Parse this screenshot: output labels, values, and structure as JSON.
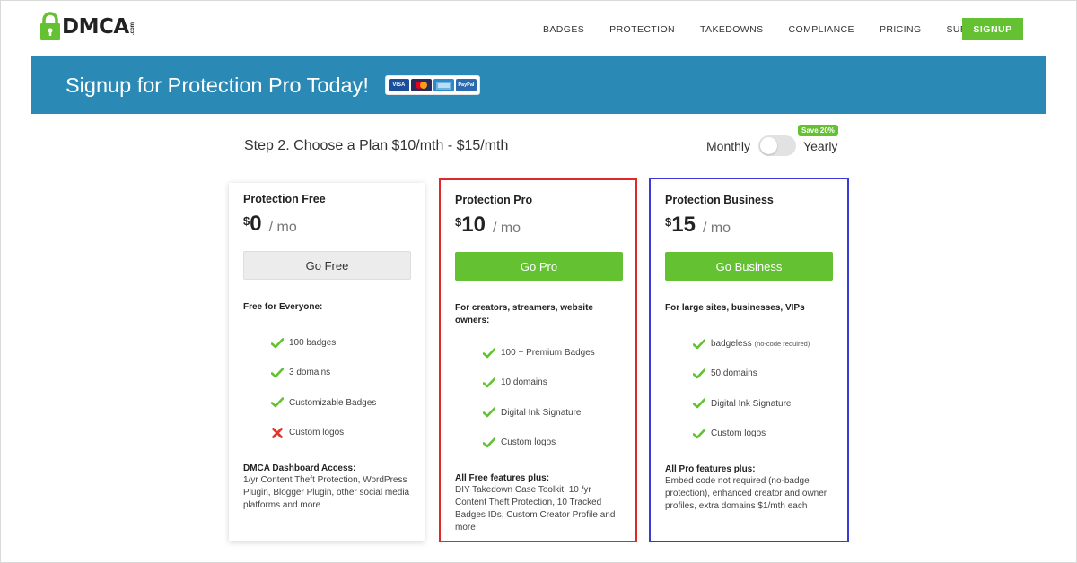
{
  "header": {
    "logo_text": "DMCA",
    "logo_suffix": ".com",
    "nav": [
      "BADGES",
      "PROTECTION",
      "TAKEDOWNS",
      "COMPLIANCE",
      "PRICING",
      "SUPPORT"
    ],
    "signup_label": "SIGNUP",
    "accent_color": "#63c132"
  },
  "banner": {
    "title": "Signup for Protection Pro Today!",
    "background_color": "#2a8ab5",
    "payment_icons": [
      "visa-icon",
      "mastercard-icon",
      "amex-icon",
      "paypal-icon"
    ],
    "payment_labels": [
      "VISA",
      "",
      "",
      "PayPal"
    ]
  },
  "step": {
    "title": "Step 2. Choose a Plan $10/mth - $15/mth"
  },
  "billing": {
    "monthly_label": "Monthly",
    "yearly_label": "Yearly",
    "save_badge": "Save 20%",
    "yearly_selected": false
  },
  "plans": [
    {
      "name": "Protection Free",
      "currency": "$",
      "amount": "0",
      "per": "/ mo",
      "button": "Go Free",
      "audience": "Free for Everyone:",
      "features": [
        {
          "icon": "check-icon",
          "text": "100 badges",
          "note": ""
        },
        {
          "icon": "check-icon",
          "text": "3 domains",
          "note": ""
        },
        {
          "icon": "check-icon",
          "text": "Customizable Badges",
          "note": ""
        },
        {
          "icon": "cross-icon",
          "text": "Custom logos",
          "note": ""
        }
      ],
      "extra_title": "DMCA Dashboard Access:",
      "extra_body": "1/yr Content Theft Protection, WordPress Plugin, Blogger Plugin, other social media platforms and more",
      "highlight_color": ""
    },
    {
      "name": "Protection Pro",
      "currency": "$",
      "amount": "10",
      "per": "/ mo",
      "button": "Go Pro",
      "audience": "For creators, streamers, website owners:",
      "features": [
        {
          "icon": "check-icon",
          "text": "100 + Premium Badges",
          "note": ""
        },
        {
          "icon": "check-icon",
          "text": "10 domains",
          "note": ""
        },
        {
          "icon": "check-icon",
          "text": "Digital Ink Signature",
          "note": ""
        },
        {
          "icon": "check-icon",
          "text": "Custom logos",
          "note": ""
        }
      ],
      "extra_title": "All Free features plus:",
      "extra_body": "DIY Takedown Case Toolkit, 10 /yr Content Theft Protection, 10 Tracked Badges IDs, Custom Creator Profile and more",
      "highlight_color": "#e02828"
    },
    {
      "name": "Protection Business",
      "currency": "$",
      "amount": "15",
      "per": "/ mo",
      "button": "Go Business",
      "audience": "For large sites, businesses, VIPs",
      "features": [
        {
          "icon": "check-icon",
          "text": "badgeless",
          "note": "(no-code required)"
        },
        {
          "icon": "check-icon",
          "text": "50 domains",
          "note": ""
        },
        {
          "icon": "check-icon",
          "text": "Digital Ink Signature",
          "note": ""
        },
        {
          "icon": "check-icon",
          "text": "Custom logos",
          "note": ""
        }
      ],
      "extra_title": "All Pro features plus:",
      "extra_body": "Embed code not required (no-badge protection), enhanced creator and owner profiles, extra domains $1/mth each",
      "highlight_color": "#3a3ad6"
    }
  ]
}
